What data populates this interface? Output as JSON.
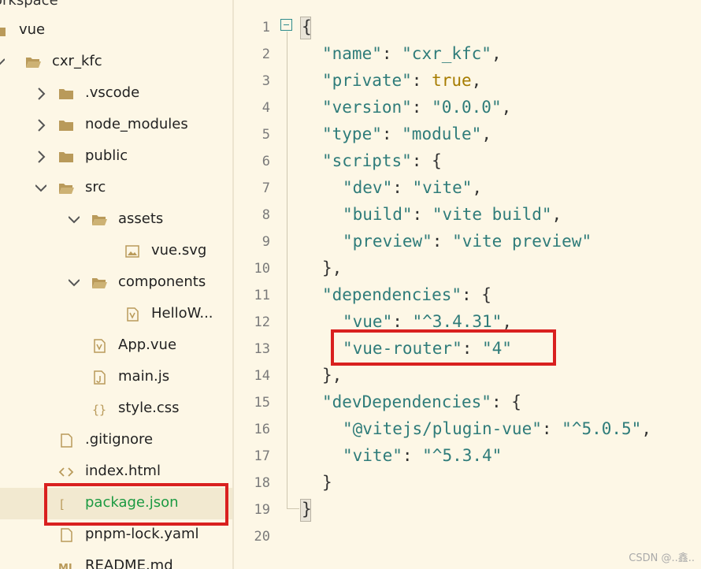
{
  "sidebar": {
    "workspace_title": "orkspace",
    "items": [
      {
        "label": "vue",
        "icon": "folder-icon",
        "chevron": "none",
        "selected": false
      },
      {
        "label": "cxr_kfc",
        "icon": "folder-open-icon",
        "chevron": "down",
        "selected": false
      },
      {
        "label": ".vscode",
        "icon": "folder-icon",
        "chevron": "right",
        "selected": false
      },
      {
        "label": "node_modules",
        "icon": "folder-icon",
        "chevron": "right",
        "selected": false
      },
      {
        "label": "public",
        "icon": "folder-icon",
        "chevron": "right",
        "selected": false
      },
      {
        "label": "src",
        "icon": "folder-open-icon",
        "chevron": "down",
        "selected": false
      },
      {
        "label": "assets",
        "icon": "folder-open-icon",
        "chevron": "down",
        "selected": false
      },
      {
        "label": "vue.svg",
        "icon": "image-file-icon",
        "chevron": "none",
        "selected": false
      },
      {
        "label": "components",
        "icon": "folder-open-icon",
        "chevron": "down",
        "selected": false
      },
      {
        "label": "HelloW...",
        "icon": "vue-file-icon",
        "chevron": "none",
        "selected": false
      },
      {
        "label": "App.vue",
        "icon": "vue-file-icon",
        "chevron": "none",
        "selected": false
      },
      {
        "label": "main.js",
        "icon": "js-file-icon",
        "chevron": "none",
        "selected": false
      },
      {
        "label": "style.css",
        "icon": "css-file-icon",
        "chevron": "none",
        "selected": false
      },
      {
        "label": ".gitignore",
        "icon": "file-icon",
        "chevron": "none",
        "selected": false
      },
      {
        "label": "index.html",
        "icon": "html-file-icon",
        "chevron": "none",
        "selected": false
      },
      {
        "label": "package.json",
        "icon": "json-file-icon",
        "chevron": "none",
        "selected": true
      },
      {
        "label": "pnpm-lock.yaml",
        "icon": "file-icon",
        "chevron": "none",
        "selected": false
      },
      {
        "label": "README.md",
        "icon": "markdown-file-icon",
        "chevron": "none",
        "selected": false
      }
    ]
  },
  "editor": {
    "line_numbers": [
      "1",
      "2",
      "3",
      "4",
      "5",
      "6",
      "7",
      "8",
      "9",
      "10",
      "11",
      "12",
      "13",
      "14",
      "15",
      "16",
      "17",
      "18",
      "19",
      "20"
    ],
    "lines": [
      [
        {
          "t": "p",
          "v": "{"
        }
      ],
      [
        {
          "t": "k",
          "v": "\"name\""
        },
        {
          "t": "p",
          "v": ": "
        },
        {
          "t": "s",
          "v": "\"cxr_kfc\""
        },
        {
          "t": "p",
          "v": ","
        }
      ],
      [
        {
          "t": "k",
          "v": "\"private\""
        },
        {
          "t": "p",
          "v": ": "
        },
        {
          "t": "b",
          "v": "true"
        },
        {
          "t": "p",
          "v": ","
        }
      ],
      [
        {
          "t": "k",
          "v": "\"version\""
        },
        {
          "t": "p",
          "v": ": "
        },
        {
          "t": "s",
          "v": "\"0.0.0\""
        },
        {
          "t": "p",
          "v": ","
        }
      ],
      [
        {
          "t": "k",
          "v": "\"type\""
        },
        {
          "t": "p",
          "v": ": "
        },
        {
          "t": "s",
          "v": "\"module\""
        },
        {
          "t": "p",
          "v": ","
        }
      ],
      [
        {
          "t": "k",
          "v": "\"scripts\""
        },
        {
          "t": "p",
          "v": ": {"
        }
      ],
      [
        {
          "t": "k",
          "v": "\"dev\""
        },
        {
          "t": "p",
          "v": ": "
        },
        {
          "t": "s",
          "v": "\"vite\""
        },
        {
          "t": "p",
          "v": ","
        }
      ],
      [
        {
          "t": "k",
          "v": "\"build\""
        },
        {
          "t": "p",
          "v": ": "
        },
        {
          "t": "s",
          "v": "\"vite build\""
        },
        {
          "t": "p",
          "v": ","
        }
      ],
      [
        {
          "t": "k",
          "v": "\"preview\""
        },
        {
          "t": "p",
          "v": ": "
        },
        {
          "t": "s",
          "v": "\"vite preview\""
        }
      ],
      [
        {
          "t": "p",
          "v": "},"
        }
      ],
      [
        {
          "t": "k",
          "v": "\"dependencies\""
        },
        {
          "t": "p",
          "v": ": {"
        }
      ],
      [
        {
          "t": "k",
          "v": "\"vue\""
        },
        {
          "t": "p",
          "v": ": "
        },
        {
          "t": "s",
          "v": "\"^3.4.31\""
        },
        {
          "t": "p",
          "v": ","
        }
      ],
      [
        {
          "t": "k",
          "v": "\"vue-router\""
        },
        {
          "t": "p",
          "v": ": "
        },
        {
          "t": "s",
          "v": "\"4\""
        }
      ],
      [
        {
          "t": "p",
          "v": "},"
        }
      ],
      [
        {
          "t": "k",
          "v": "\"devDependencies\""
        },
        {
          "t": "p",
          "v": ": {"
        }
      ],
      [
        {
          "t": "k",
          "v": "\"@vitejs/plugin-vue\""
        },
        {
          "t": "p",
          "v": ": "
        },
        {
          "t": "s",
          "v": "\"^5.0.5\""
        },
        {
          "t": "p",
          "v": ","
        }
      ],
      [
        {
          "t": "k",
          "v": "\"vite\""
        },
        {
          "t": "p",
          "v": ": "
        },
        {
          "t": "s",
          "v": "\"^5.3.4\""
        }
      ],
      [
        {
          "t": "p",
          "v": "}"
        }
      ],
      [
        {
          "t": "p",
          "v": "}"
        }
      ],
      []
    ]
  },
  "watermark": "CSDN @..鑫..",
  "colors": {
    "key": "#2f7c7a",
    "string": "#2f7c7a",
    "boolean": "#a67c00",
    "highlight_box": "#d9201f",
    "selected_label": "#1c9a42"
  }
}
